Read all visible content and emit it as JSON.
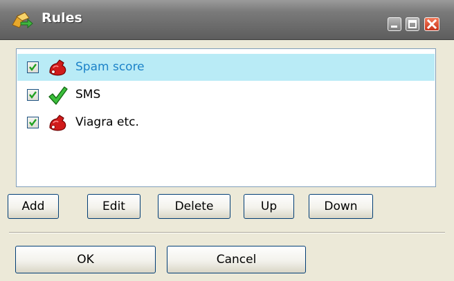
{
  "window": {
    "title": "Rules",
    "title_icon": "rules-icon",
    "controls": [
      "minimize-icon",
      "maximize-icon",
      "close-icon"
    ]
  },
  "rules": [
    {
      "label": "Spam score",
      "checked": true,
      "icon": "red-hand-icon",
      "selected": true
    },
    {
      "label": "SMS",
      "checked": true,
      "icon": "green-check-icon",
      "selected": false
    },
    {
      "label": "Viagra etc.",
      "checked": true,
      "icon": "red-hand-icon",
      "selected": false
    }
  ],
  "actions": {
    "add": "Add",
    "edit": "Edit",
    "delete": "Delete",
    "up": "Up",
    "down": "Down"
  },
  "footer": {
    "ok": "OK",
    "cancel": "Cancel"
  },
  "colors": {
    "selection": "#b9ebf6",
    "selected_text": "#1c82c8",
    "dialog_bg": "#ece9d8",
    "titlebar": "#6e6e6e"
  }
}
